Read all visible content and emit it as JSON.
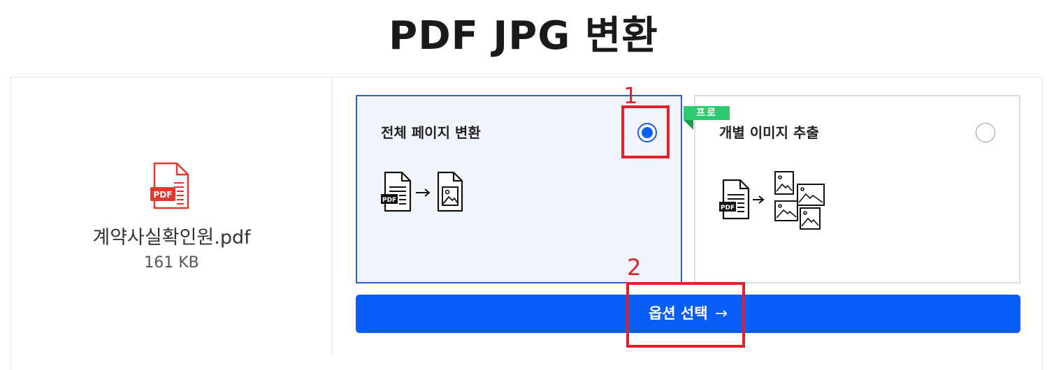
{
  "page": {
    "title": "PDF JPG 변환"
  },
  "file": {
    "name": "계약사실확인원.pdf",
    "size": "161 KB",
    "badge": "PDF"
  },
  "options": [
    {
      "label": "전체 페이지 변환",
      "selected": true,
      "icon": "pdf-to-image-icon"
    },
    {
      "label": "개별 이미지 추출",
      "selected": false,
      "badge": "프로",
      "icon": "extract-images-icon"
    }
  ],
  "submit": {
    "label": "옵션 선택",
    "arrow": "→"
  },
  "annotations": [
    {
      "number": "1"
    },
    {
      "number": "2"
    }
  ],
  "colors": {
    "primary": "#0a5ef8",
    "pro": "#2ccb6f",
    "annotation": "#e0202a",
    "pdf_red": "#e03a2f"
  }
}
